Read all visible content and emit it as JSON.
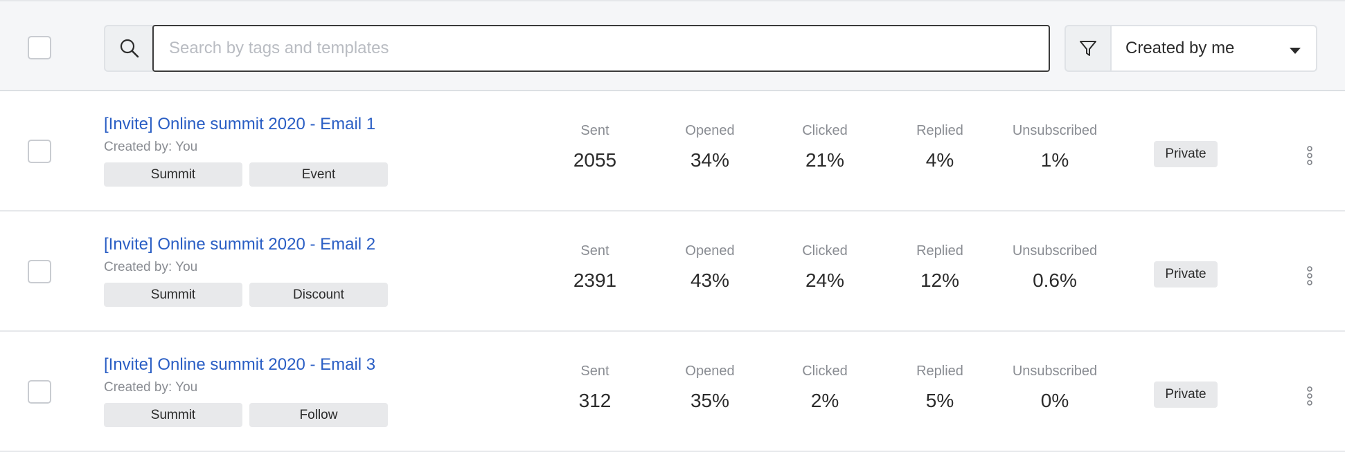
{
  "toolbar": {
    "search_placeholder": "Search by tags and templates",
    "search_icon": "search-icon",
    "filter_icon": "filter-icon",
    "filter_dropdown": {
      "selected": "Created by me",
      "icon": "caret-down-icon"
    }
  },
  "stat_labels": {
    "sent": "Sent",
    "opened": "Opened",
    "clicked": "Clicked",
    "replied": "Replied",
    "unsubscribed": "Unsubscribed"
  },
  "rows": [
    {
      "title": "[Invite] Online summit 2020 - Email 1",
      "created_by": "Created by: You",
      "tags": [
        "Summit",
        "Event"
      ],
      "sent": "2055",
      "opened": "34%",
      "clicked": "21%",
      "replied": "4%",
      "unsubscribed": "1%",
      "visibility": "Private"
    },
    {
      "title": "[Invite] Online summit 2020 - Email 2",
      "created_by": "Created by: You",
      "tags": [
        "Summit",
        "Discount"
      ],
      "sent": "2391",
      "opened": "43%",
      "clicked": "24%",
      "replied": "12%",
      "unsubscribed": "0.6%",
      "visibility": "Private"
    },
    {
      "title": "[Invite] Online summit 2020 - Email 3",
      "created_by": "Created by: You",
      "tags": [
        "Summit",
        "Follow"
      ],
      "sent": "312",
      "opened": "35%",
      "clicked": "2%",
      "replied": "5%",
      "unsubscribed": "0%",
      "visibility": "Private"
    }
  ],
  "colors": {
    "link": "#2a5ec4",
    "muted": "#8a8d93",
    "toolbar_bg": "#f5f6f8",
    "tag_bg": "#e8e9eb"
  }
}
